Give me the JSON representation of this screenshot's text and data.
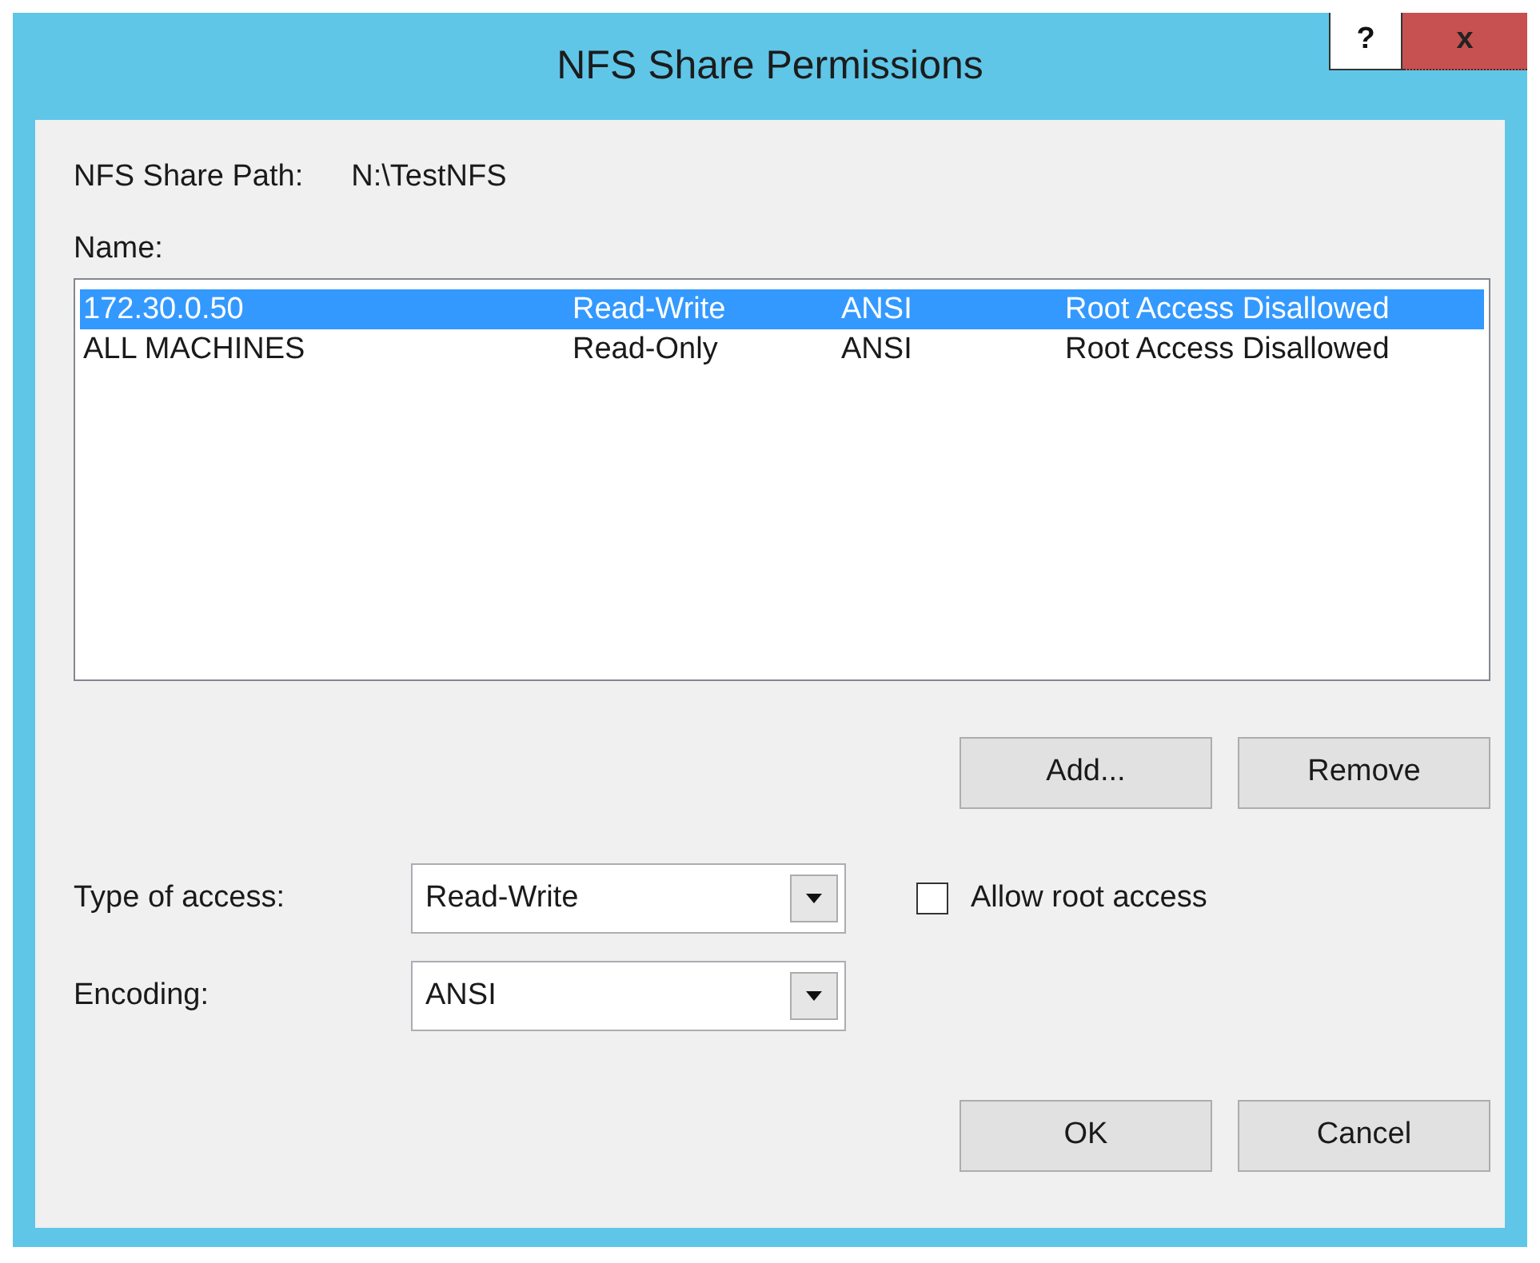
{
  "window": {
    "title": "NFS Share Permissions",
    "help_button": "?",
    "close_button": "x"
  },
  "share_path": {
    "label": "NFS Share Path:",
    "value": "N:\\TestNFS"
  },
  "list_label": "Name:",
  "entries": [
    {
      "name": "172.30.0.50",
      "access": "Read-Write",
      "encoding": "ANSI",
      "root": "Root Access Disallowed",
      "selected": true
    },
    {
      "name": "ALL MACHINES",
      "access": "Read-Only",
      "encoding": "ANSI",
      "root": "Root Access Disallowed",
      "selected": false
    }
  ],
  "list_buttons": [
    "Add...",
    "Remove"
  ],
  "type_of_access": {
    "label": "Type of access:",
    "value": "Read-Write"
  },
  "allow_root": {
    "label": "Allow root access",
    "checked": false
  },
  "encoding": {
    "label": "Encoding:",
    "value": "ANSI"
  },
  "dialog_buttons": [
    "OK",
    "Cancel"
  ]
}
